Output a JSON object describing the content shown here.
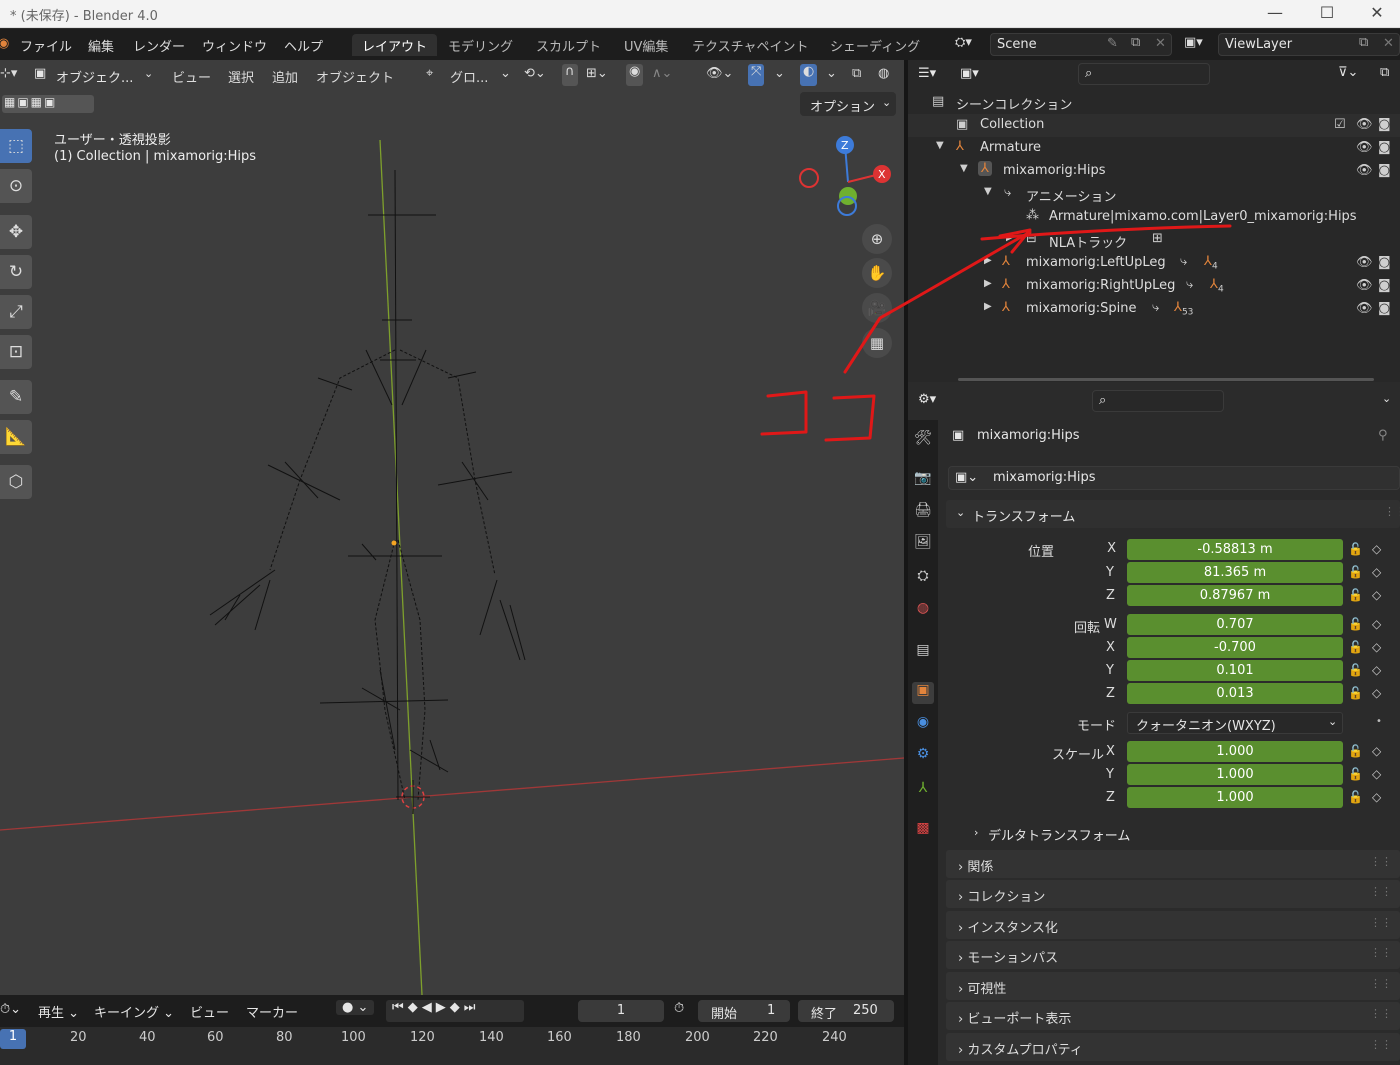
{
  "window": {
    "title": "* (未保存) - Blender 4.0"
  },
  "menu": [
    "ファイル",
    "編集",
    "レンダー",
    "ウィンドウ",
    "ヘルプ"
  ],
  "workspaces": [
    "レイアウト",
    "モデリング",
    "スカルプト",
    "UV編集",
    "テクスチャペイント",
    "シェーディング"
  ],
  "scene": {
    "scene_name": "Scene",
    "view_layer": "ViewLayer"
  },
  "viewport": {
    "mode": "オブジェク...",
    "menus": [
      "ビュー",
      "選択",
      "追加",
      "オブジェクト"
    ],
    "transform_orientation": "グロ...",
    "options_label": "オプション",
    "overlay_line1": "ユーザー・透視投影",
    "overlay_line2": "(1) Collection | mixamorig:Hips"
  },
  "outliner": {
    "scene_collection": "シーンコレクション",
    "rows": [
      {
        "label": "Collection"
      },
      {
        "label": "Armature"
      },
      {
        "label": "mixamorig:Hips"
      },
      {
        "label": "アニメーション"
      },
      {
        "label": "Armature|mixamo.com|Layer0_mixamorig:Hips"
      },
      {
        "label": "NLAトラック"
      },
      {
        "label": "mixamorig:LeftUpLeg",
        "count": "4"
      },
      {
        "label": "mixamorig:RightUpLeg",
        "count": "4"
      },
      {
        "label": "mixamorig:Spine",
        "count": "53"
      }
    ]
  },
  "annotation": {
    "text": "ココ",
    "color": "#e01818"
  },
  "properties": {
    "object_name": "mixamorig:Hips",
    "bone_field": "mixamorig:Hips",
    "transform_header": "トランスフォーム",
    "location_label": "位置",
    "location": [
      {
        "axis": "X",
        "value": "-0.58813 m"
      },
      {
        "axis": "Y",
        "value": "81.365 m"
      },
      {
        "axis": "Z",
        "value": "0.87967 m"
      }
    ],
    "rotation_label": "回転",
    "rotation": [
      {
        "axis": "W",
        "value": "0.707"
      },
      {
        "axis": "X",
        "value": "-0.700"
      },
      {
        "axis": "Y",
        "value": "0.101"
      },
      {
        "axis": "Z",
        "value": "0.013"
      }
    ],
    "mode_label": "モード",
    "mode_value": "クォータニオン(WXYZ)",
    "scale_label": "スケール",
    "scale": [
      {
        "axis": "X",
        "value": "1.000"
      },
      {
        "axis": "Y",
        "value": "1.000"
      },
      {
        "axis": "Z",
        "value": "1.000"
      }
    ],
    "delta_transform": "デルタトランスフォーム",
    "panels": [
      "関係",
      "コレクション",
      "インスタンス化",
      "モーションパス",
      "可視性",
      "ビューポート表示",
      "カスタムプロパティ"
    ]
  },
  "timeline": {
    "playback": "再生",
    "keying": "キーイング",
    "view": "ビュー",
    "marker": "マーカー",
    "current_frame": "1",
    "start_label": "開始",
    "start": "1",
    "end_label": "終了",
    "end": "250",
    "ruler": [
      "1",
      "20",
      "40",
      "60",
      "80",
      "100",
      "120",
      "140",
      "160",
      "180",
      "200",
      "220",
      "240"
    ]
  },
  "colors": {
    "accent": "#4772b3",
    "field_green": "#5a8f2f",
    "bone_orange": "#e2843c"
  }
}
